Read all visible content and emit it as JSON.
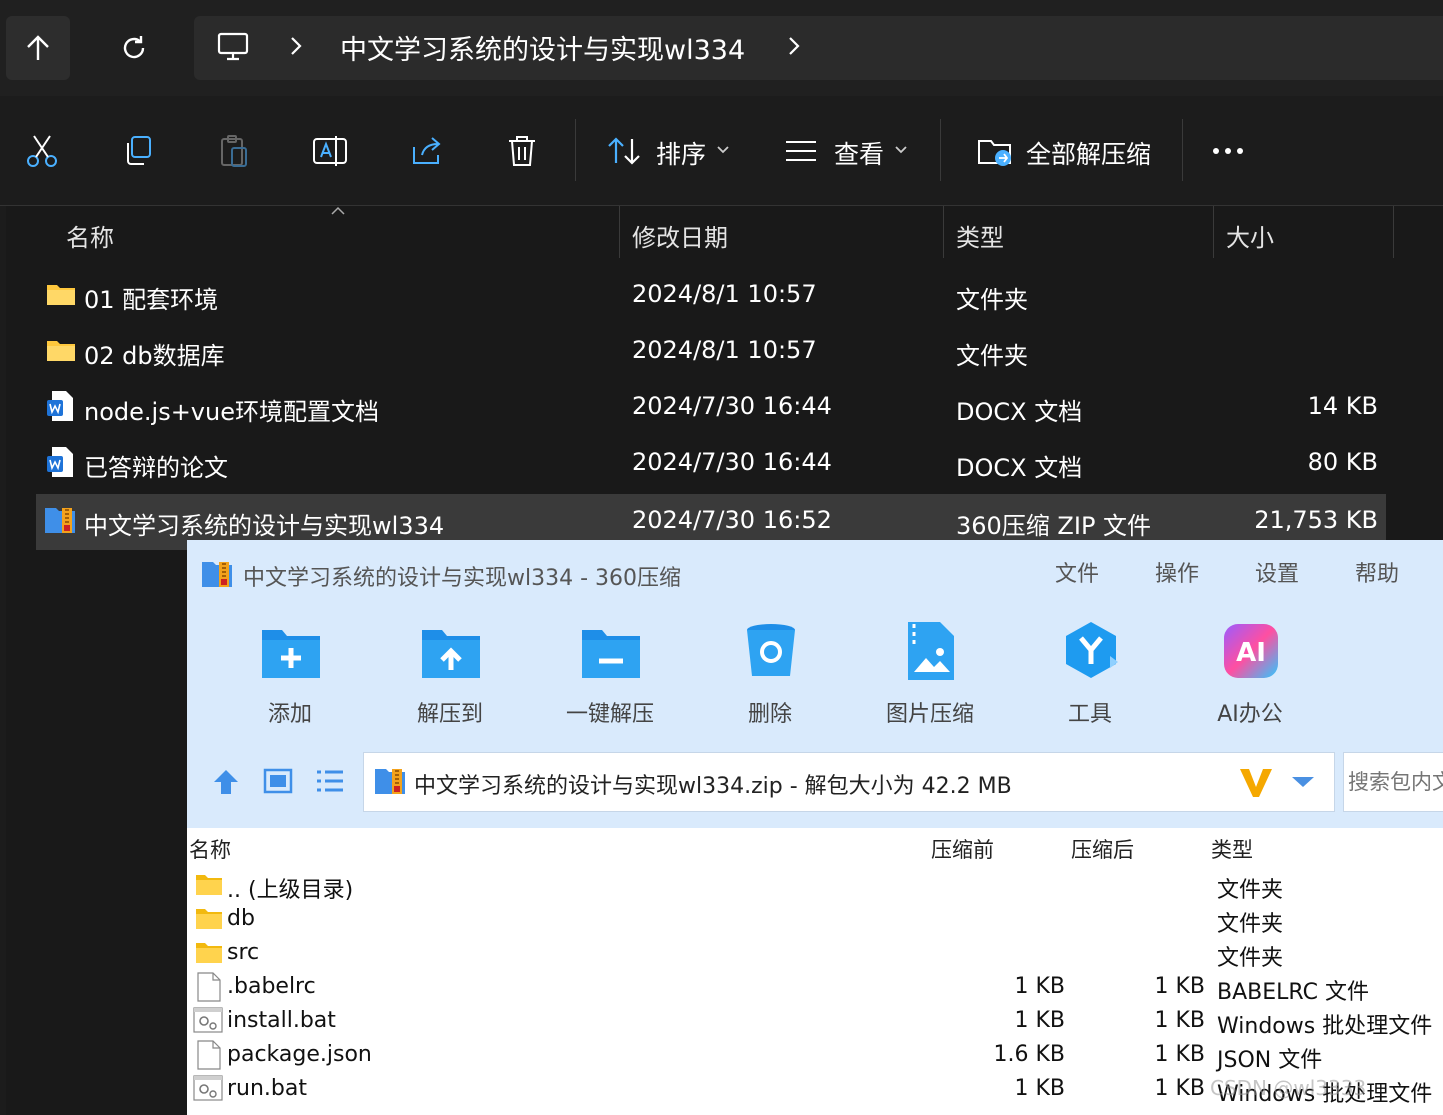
{
  "explorer": {
    "address_title": "中文学习系统的设计与实现wl334",
    "toolbar": {
      "sort_label": "排序",
      "view_label": "查看",
      "extract_all_label": "全部解压缩"
    },
    "columns": {
      "name": "名称",
      "date": "修改日期",
      "type": "类型",
      "size": "大小"
    },
    "files": [
      {
        "name": "01 配套环境",
        "date": "2024/8/1 10:57",
        "type": "文件夹",
        "size": ""
      },
      {
        "name": "02 db数据库",
        "date": "2024/8/1 10:57",
        "type": "文件夹",
        "size": ""
      },
      {
        "name": "node.js+vue环境配置文档",
        "date": "2024/7/30 16:44",
        "type": "DOCX 文档",
        "size": "14 KB"
      },
      {
        "name": "已答辩的论文",
        "date": "2024/7/30 16:44",
        "type": "DOCX 文档",
        "size": "80 KB"
      },
      {
        "name": "中文学习系统的设计与实现wl334",
        "date": "2024/7/30 16:52",
        "type": "360压缩 ZIP 文件",
        "size": "21,753 KB"
      }
    ]
  },
  "zip_window": {
    "title": "中文学习系统的设计与实现wl334 - 360压缩",
    "menu": [
      "文件",
      "操作",
      "设置",
      "帮助"
    ],
    "tools": [
      "添加",
      "解压到",
      "一键解压",
      "删除",
      "图片压缩",
      "工具",
      "AI办公"
    ],
    "address": "中文学习系统的设计与实现wl334.zip - 解包大小为 42.2 MB",
    "search_placeholder": "搜索包内文件",
    "columns": {
      "name": "名称",
      "before": "压缩前",
      "after": "压缩后",
      "type": "类型"
    },
    "items": [
      {
        "name": ".. (上级目录)",
        "before": "",
        "after": "",
        "type": "文件夹"
      },
      {
        "name": "db",
        "before": "",
        "after": "",
        "type": "文件夹"
      },
      {
        "name": "src",
        "before": "",
        "after": "",
        "type": "文件夹"
      },
      {
        "name": ".babelrc",
        "before": "1 KB",
        "after": "1 KB",
        "type": "BABELRC 文件"
      },
      {
        "name": "install.bat",
        "before": "1 KB",
        "after": "1 KB",
        "type": "Windows 批处理文件"
      },
      {
        "name": "package.json",
        "before": "1.6 KB",
        "after": "1 KB",
        "type": "JSON 文件"
      },
      {
        "name": "run.bat",
        "before": "1 KB",
        "after": "1 KB",
        "type": "Windows 批处理文件"
      }
    ]
  },
  "watermark": "CSDN @wl3333",
  "colors": {
    "accent_blue": "#1e9bf0",
    "folder_yellow": "#ffc83d",
    "zip_bg": "#d9eafc"
  }
}
